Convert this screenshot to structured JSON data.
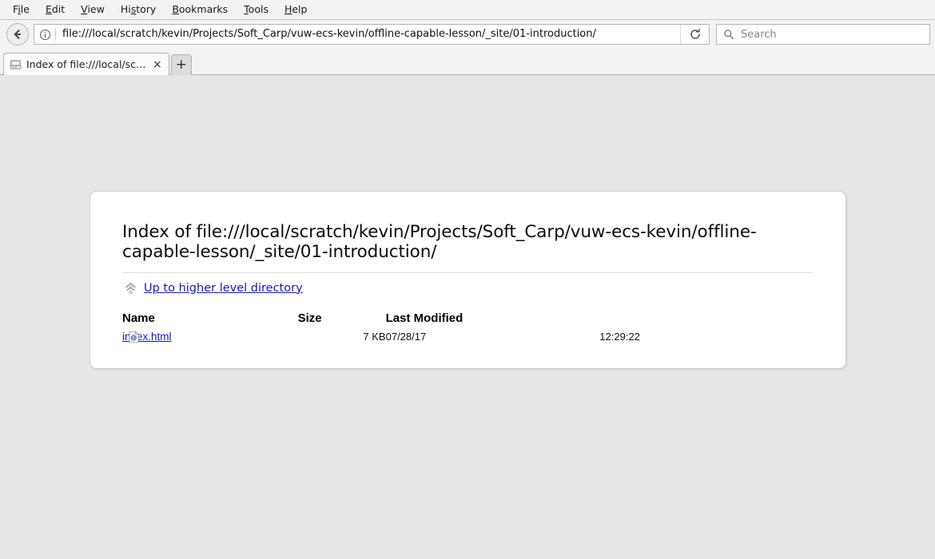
{
  "browser": {
    "menubar": [
      {
        "pre": "F",
        "key": "i",
        "post": "le",
        "name": "file"
      },
      {
        "pre": "",
        "key": "E",
        "post": "dit",
        "name": "edit"
      },
      {
        "pre": "",
        "key": "V",
        "post": "iew",
        "name": "view"
      },
      {
        "pre": "Hi",
        "key": "s",
        "post": "tory",
        "name": "history"
      },
      {
        "pre": "",
        "key": "B",
        "post": "ookmarks",
        "name": "bookmarks"
      },
      {
        "pre": "",
        "key": "T",
        "post": "ools",
        "name": "tools"
      },
      {
        "pre": "",
        "key": "H",
        "post": "elp",
        "name": "help"
      }
    ],
    "toolbar": {
      "back_icon": "back-arrow-icon",
      "identity_icon": "info-circle-icon",
      "reload_icon": "reload-icon",
      "url": "file:///local/scratch/kevin/Projects/Soft_Carp/vuw-ecs-kevin/offline-capable-lesson/_site/01-introduction/",
      "search_icon": "search-icon",
      "search_placeholder": "Search",
      "search_value": ""
    },
    "tabs": [
      {
        "favicon": "drive-icon",
        "title": "Index of file:///local/scr...",
        "close_label": "×",
        "active": true
      }
    ],
    "new_tab_label": "+"
  },
  "page": {
    "heading": "Index of file:///local/scratch/kevin/Projects/Soft_Carp/vuw-ecs-kevin/offline-capable-lesson/_site/01-introduction/",
    "up_link": {
      "icon": "up-directory-icon",
      "label": "Up to higher level directory"
    },
    "table": {
      "columns": [
        "Name",
        "Size",
        "Last Modified"
      ],
      "rows": [
        {
          "icon": "html-file-icon",
          "name": "index.html",
          "size": "7 KB",
          "date": "07/28/17",
          "time": "12:29:22"
        }
      ]
    }
  },
  "colors": {
    "link": "#1414cf",
    "page_background": "#e6e6e4",
    "content_background": "#ffffff",
    "chrome_background": "#f3f3f1"
  }
}
